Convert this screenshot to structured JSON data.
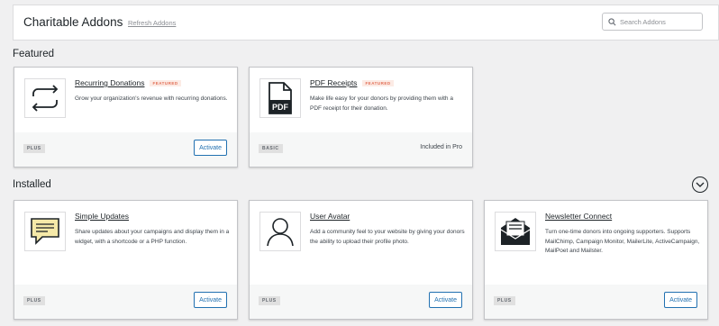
{
  "header": {
    "title": "Charitable Addons",
    "refresh_label": "Refresh Addons",
    "search_placeholder": "Search Addons"
  },
  "sections": {
    "featured_title": "Featured",
    "installed_title": "Installed"
  },
  "featured": [
    {
      "name": "Recurring Donations",
      "badge": "FEATURED",
      "description": "Grow your organization's revenue with recurring donations.",
      "tier": "PLUS",
      "action": "Activate",
      "icon": "recurring-icon"
    },
    {
      "name": "PDF Receipts",
      "badge": "FEATURED",
      "description": "Make life easy for your donors by providing them with a PDF receipt for their donation.",
      "tier": "BASIC",
      "status": "Included in Pro",
      "icon": "pdf-icon"
    }
  ],
  "installed": [
    {
      "name": "Simple Updates",
      "description": "Share updates about your campaigns and display them in a widget, with a shortcode or a PHP function.",
      "tier": "PLUS",
      "action": "Activate",
      "icon": "chat-bubble-icon",
      "icon_color": "#f5e9a8"
    },
    {
      "name": "User Avatar",
      "description": "Add a community feel to your website by giving your donors the ability to upload their profile photo.",
      "tier": "PLUS",
      "action": "Activate",
      "icon": "user-icon"
    },
    {
      "name": "Newsletter Connect",
      "description": "Turn one-time donors into ongoing supporters. Supports MailChimp, Campaign Monitor, MailerLite, ActiveCampaign, MailPoet and Mailster.",
      "tier": "PLUS",
      "action": "Activate",
      "icon": "newsletter-icon"
    }
  ],
  "colors": {
    "accent": "#2271b1",
    "featured_badge": "#e26f56",
    "background": "#f0f0f1"
  }
}
